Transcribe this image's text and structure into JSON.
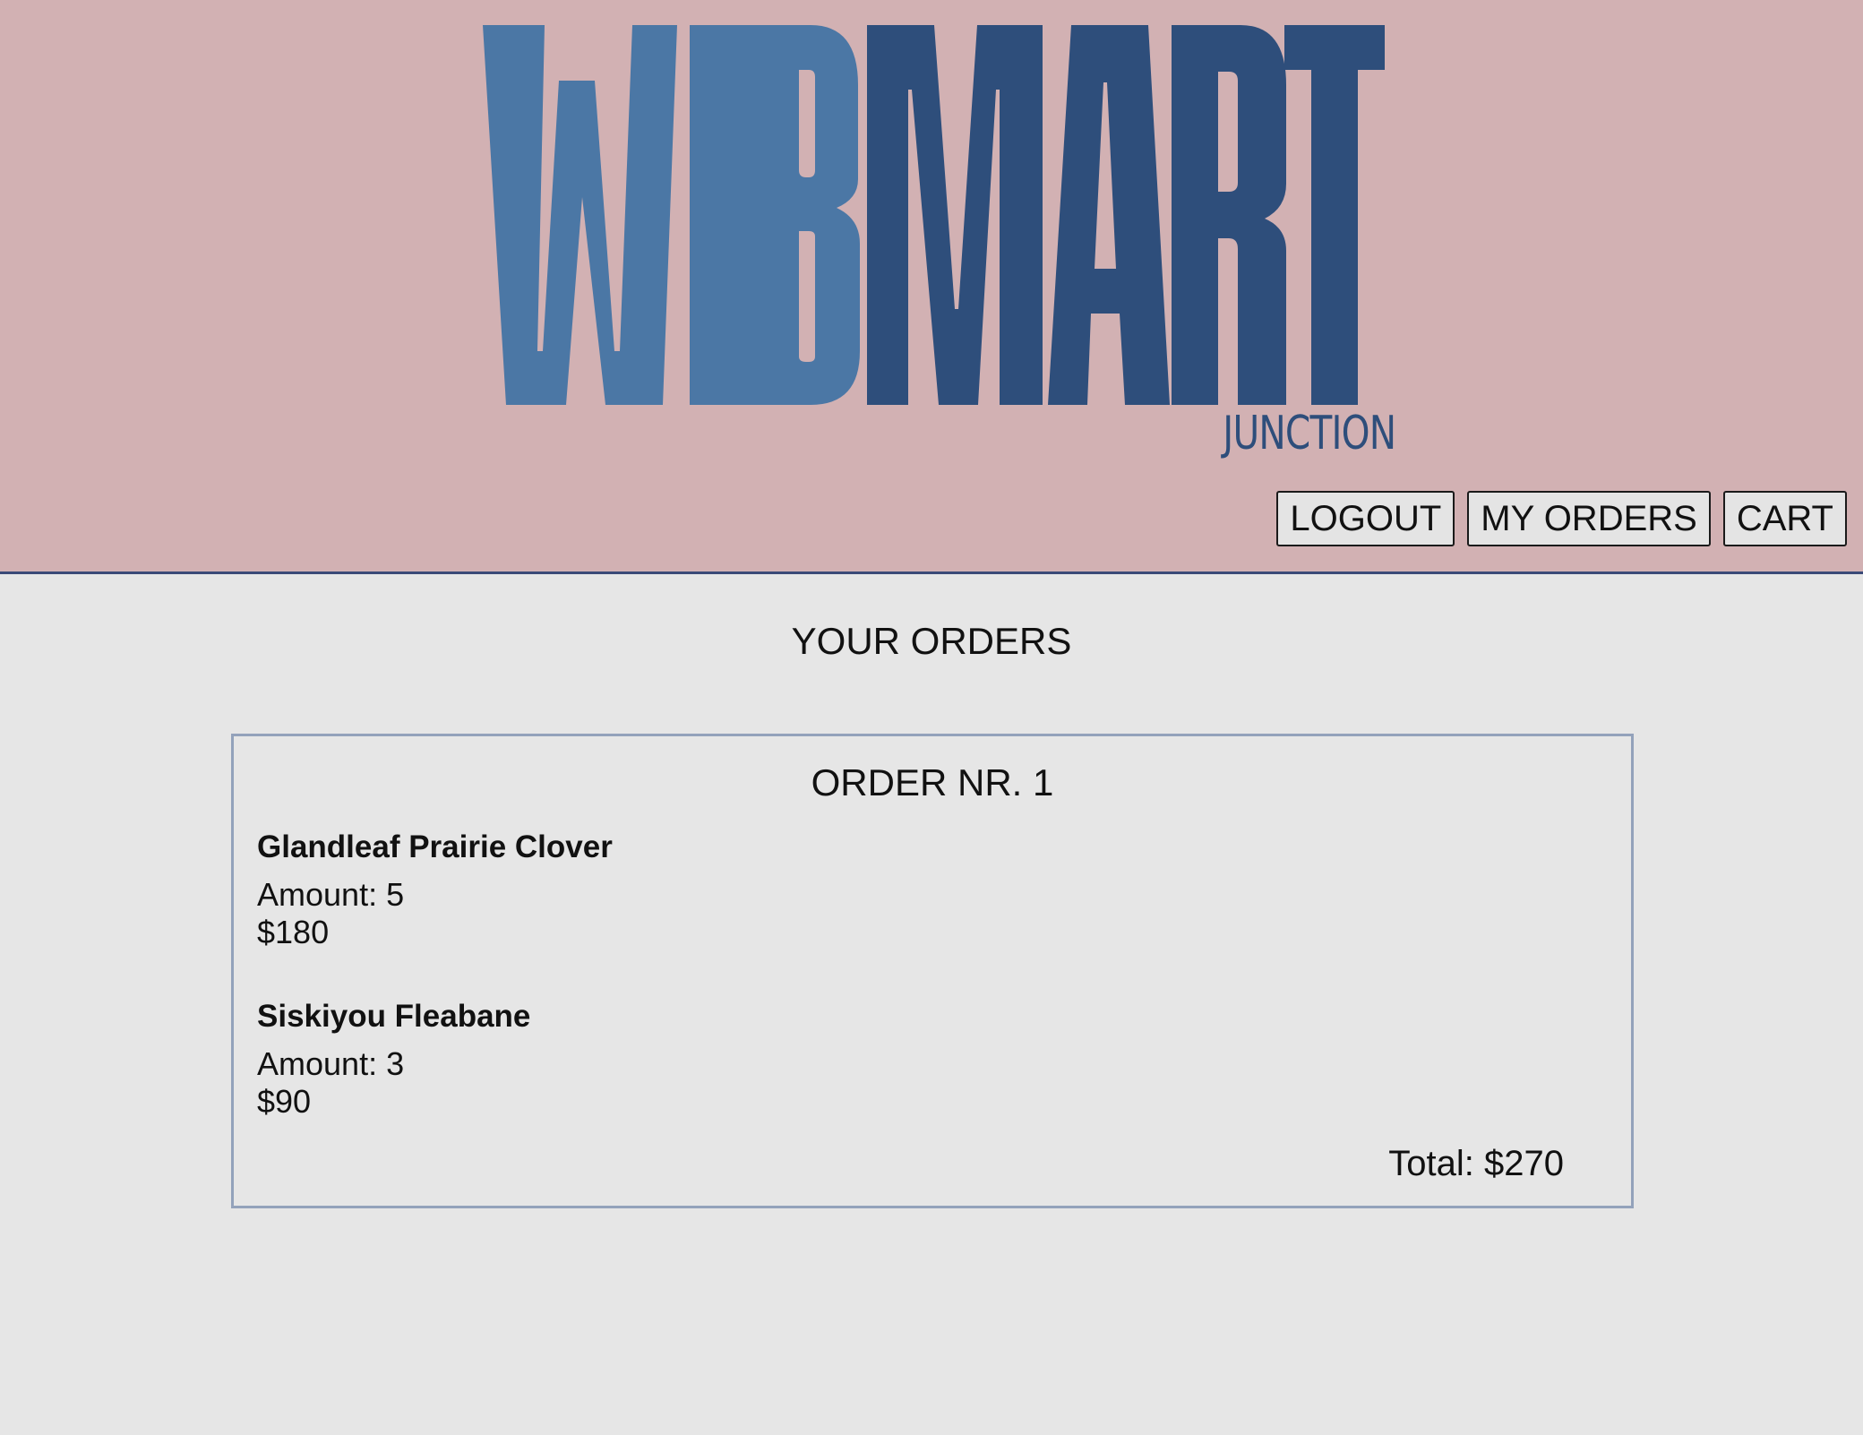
{
  "brand": {
    "logo_word_1": "WEB",
    "logo_word_2": "MART",
    "logo_tagline": "JUNCTION",
    "colors": {
      "header_bg": "#d2b1b3",
      "logo_light": "#4b77a5",
      "logo_dark": "#2e4e7b",
      "page_bg": "#e6e6e6",
      "card_border": "#93a2bb"
    }
  },
  "nav": {
    "logout_label": "LOGOUT",
    "orders_label": "MY ORDERS",
    "cart_label": "CART"
  },
  "main": {
    "title": "YOUR ORDERS",
    "orders": [
      {
        "title": "ORDER NR. 1",
        "items": [
          {
            "name": "Glandleaf Prairie Clover",
            "amount": "Amount: 5",
            "price": "$180"
          },
          {
            "name": "Siskiyou Fleabane",
            "amount": "Amount: 3",
            "price": "$90"
          }
        ],
        "total": "Total: $270"
      }
    ]
  }
}
